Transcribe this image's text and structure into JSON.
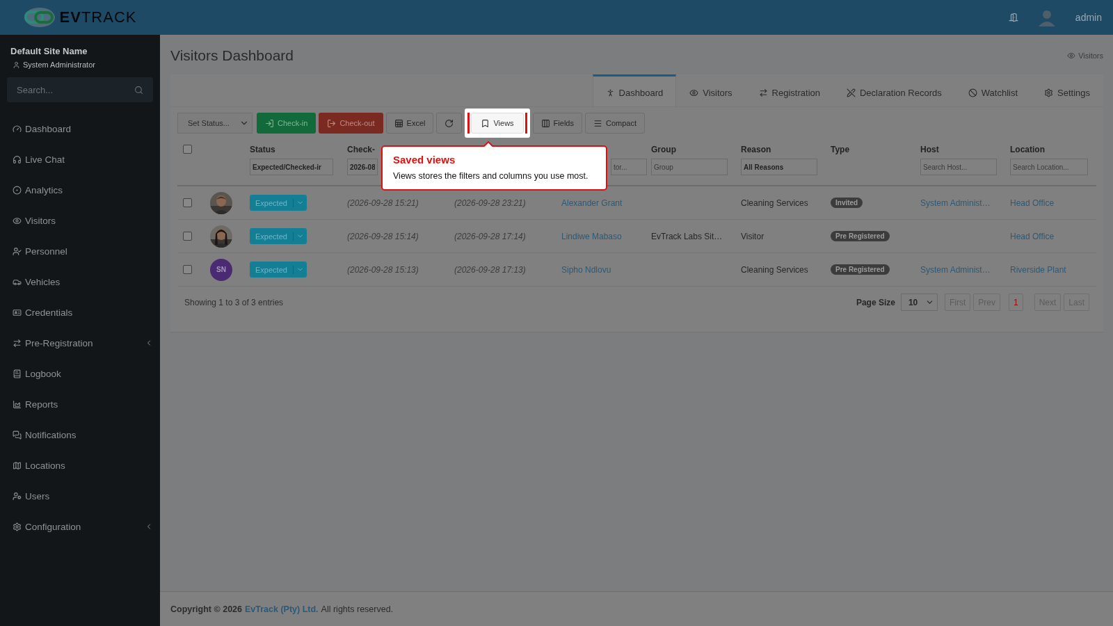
{
  "header": {
    "logo": "**EV**TRACK",
    "user": "admin"
  },
  "sidebar": {
    "site_name": "Default Site Name",
    "role": "System Administrator",
    "search": {
      "placeholder": "Search..."
    },
    "items": [
      {
        "label": "Dashboard",
        "has_submenu": false
      },
      {
        "label": "Live Chat",
        "has_submenu": false
      },
      {
        "label": "Analytics",
        "has_submenu": false
      },
      {
        "label": "Visitors",
        "has_submenu": false
      },
      {
        "label": "Personnel",
        "has_submenu": false
      },
      {
        "label": "Vehicles",
        "has_submenu": false
      },
      {
        "label": "Credentials",
        "has_submenu": false
      },
      {
        "label": "Pre-Registration",
        "has_submenu": true
      },
      {
        "label": "Logbook",
        "has_submenu": false
      },
      {
        "label": "Reports",
        "has_submenu": false
      },
      {
        "label": "Notifications",
        "has_submenu": false
      },
      {
        "label": "Locations",
        "has_submenu": false
      },
      {
        "label": "Users",
        "has_submenu": false
      },
      {
        "label": "Configuration",
        "has_submenu": true
      }
    ]
  },
  "page": {
    "title": "Visitors Dashboard",
    "breadcrumb": "Visitors"
  },
  "tabs": [
    {
      "label": "Dashboard",
      "selected": true
    },
    {
      "label": "Visitors",
      "selected": false
    },
    {
      "label": "Registration",
      "selected": false
    },
    {
      "label": "Declaration Records",
      "selected": false
    },
    {
      "label": "Watchlist",
      "selected": false
    },
    {
      "label": "Settings",
      "selected": false
    }
  ],
  "toolbar": {
    "status_select": {
      "value": "Set Status..."
    },
    "buttons": [
      {
        "kind": "success",
        "label": "Check-in",
        "highlighted": false
      },
      {
        "kind": "danger",
        "label": "Check-out",
        "highlighted": false
      },
      {
        "kind": "excel",
        "label": "Excel",
        "highlighted": false
      },
      {
        "kind": "refresh",
        "highlighted": false
      },
      {
        "kind": "views",
        "label": "Views",
        "highlighted": true
      },
      {
        "kind": "fields",
        "label": "Fields",
        "highlighted": false
      },
      {
        "kind": "compact",
        "label": "Compact",
        "highlighted": false
      }
    ]
  },
  "tour_popover": {
    "title": "Saved views",
    "text": "Views stores the filters and columns you use most."
  },
  "table": {
    "select_all": {
      "checked": false
    },
    "columns": [
      {
        "header": "Status",
        "filter": {
          "value": "Expected/Checked-ir"
        }
      },
      {
        "header": "Check-",
        "filter": {
          "value": "2026-08"
        }
      },
      {},
      {
        "filter": {
          "placeholder": "tor..."
        }
      },
      {
        "header": "Group",
        "filter": {
          "placeholder": "Group"
        }
      },
      {
        "header": "Reason",
        "filter": {
          "value": "All Reasons"
        }
      },
      {
        "header": "Type"
      },
      {
        "header": "Host",
        "filter": {
          "placeholder": "Search Host..."
        }
      },
      {
        "header": "Location",
        "filter": {
          "placeholder": "Search Location..."
        }
      }
    ],
    "rows": [
      {
        "checked": false,
        "status": "Expected",
        "check_in": "(2026-09-28 15:21)",
        "check_out": "(2026-09-28 23:21)",
        "name": "Alexander Grant",
        "reason": "Cleaning Services",
        "type": "Invited",
        "host": "System Administ…",
        "location": "Head Office"
      },
      {
        "checked": false,
        "status": "Expected",
        "check_in": "(2026-09-28 15:14)",
        "check_out": "(2026-09-28 17:14)",
        "name": "Lindiwe Mabaso",
        "group": "EvTrack Labs Sit…",
        "reason": "Visitor",
        "type": "Pre Registered",
        "location": "Head Office"
      },
      {
        "checked": false,
        "avatar": {
          "kind": "initials",
          "text": "SN",
          "color": "#4a2a72"
        },
        "status": "Expected",
        "check_in": "(2026-09-28 15:13)",
        "check_out": "(2026-09-28 17:13)",
        "name": "Sipho Ndlovu",
        "reason": "Cleaning Services",
        "type": "Pre Registered",
        "host": "System Administ…",
        "location": "Riverside Plant"
      }
    ],
    "summary": "Showing 1 to 3 of 3 entries",
    "page_size": {
      "label": "Page Size",
      "value": "10"
    },
    "pagination": [
      {
        "label": "First",
        "selected": false,
        "disabled": true
      },
      {
        "label": "Prev",
        "selected": false,
        "disabled": true
      },
      {
        "label": "1",
        "selected": true,
        "disabled": false
      },
      {
        "label": "Next",
        "selected": false,
        "disabled": true
      },
      {
        "label": "Last",
        "selected": false,
        "disabled": true
      }
    ]
  },
  "footer": {
    "text": "**Copyright © 2026**",
    "link": "EvTrack (Pty) Ltd.",
    "rest": "All rights reserved."
  }
}
